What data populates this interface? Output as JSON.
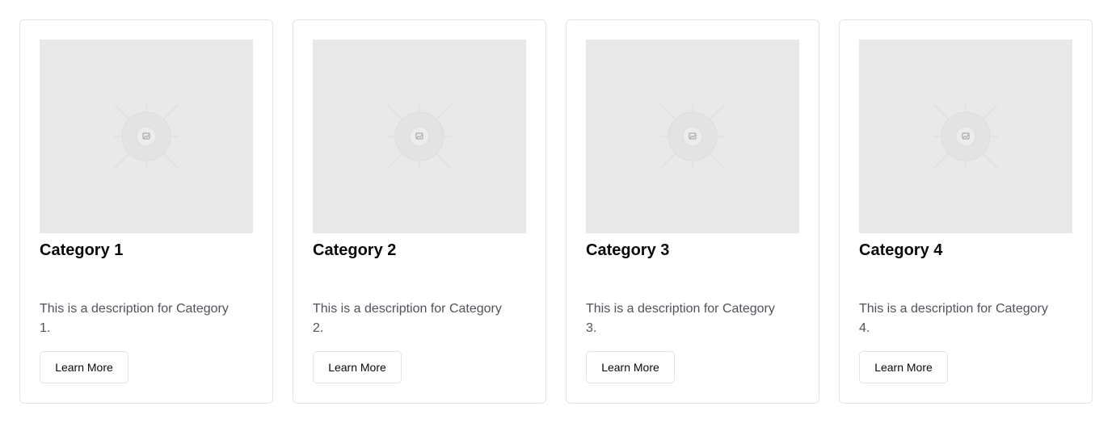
{
  "cards": [
    {
      "title": "Category 1",
      "description_line1": "This is a description for Category",
      "description_line2": "1.",
      "button_label": "Learn More",
      "image_icon": "image-placeholder-icon"
    },
    {
      "title": "Category 2",
      "description_line1": "This is a description for Category",
      "description_line2": "2.",
      "button_label": "Learn More",
      "image_icon": "image-placeholder-icon"
    },
    {
      "title": "Category 3",
      "description_line1": "This is a description for Category",
      "description_line2": "3.",
      "button_label": "Learn More",
      "image_icon": "image-placeholder-icon"
    },
    {
      "title": "Category 4",
      "description_line1": "This is a description for Category",
      "description_line2": "4.",
      "button_label": "Learn More",
      "image_icon": "image-placeholder-icon"
    }
  ],
  "colors": {
    "card_border": "#e4e4e7",
    "image_placeholder_bg": "#e9e9e9",
    "title_text": "#09090b",
    "description_text": "#52525b"
  }
}
